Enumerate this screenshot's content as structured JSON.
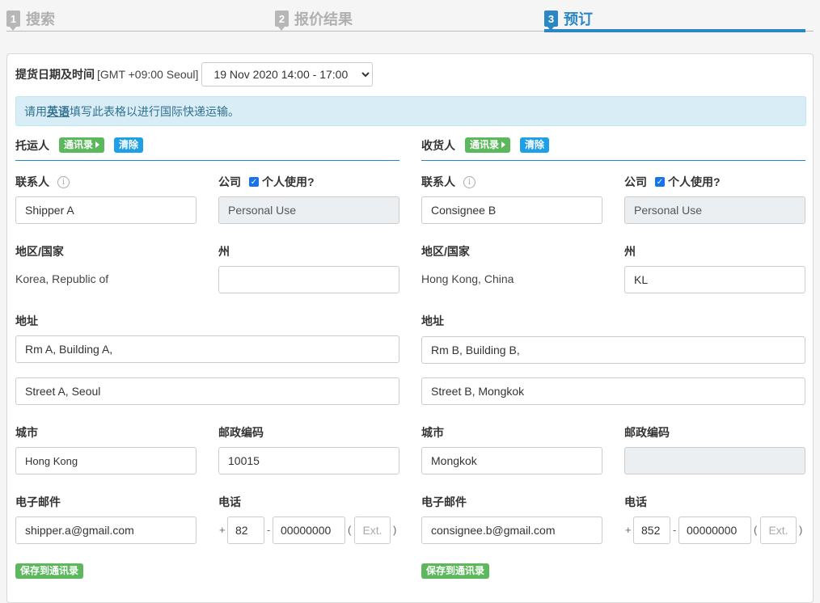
{
  "steps": [
    {
      "num": "1",
      "label": "搜索"
    },
    {
      "num": "2",
      "label": "报价结果"
    },
    {
      "num": "3",
      "label": "预订"
    }
  ],
  "pickup": {
    "label": "提货日期及时间",
    "timezone": "[GMT +09:00 Seoul]",
    "selected": "19 Nov 2020 14:00 - 17:00"
  },
  "notice": {
    "prefix": "请用",
    "emphasis": "英语",
    "suffix": "填写此表格以进行国际快递运输。"
  },
  "shipper": {
    "title": "托运人",
    "address_book": "通讯录",
    "clear": "清除",
    "contact_label": "联系人",
    "contact_value": "Shipper A",
    "company_label": "公司",
    "personal_label": "个人使用?",
    "company_value": "Personal Use",
    "country_label": "地区/国家",
    "country_value": "Korea, Republic of",
    "state_label": "州",
    "state_value": "",
    "address_label": "地址",
    "address1": "Rm A, Building A,",
    "address2": "Street A, Seoul",
    "city_label": "城市",
    "city_value": "Hong Kong",
    "postcode_label": "邮政编码",
    "postcode_value": "10015",
    "email_label": "电子邮件",
    "email_value": "shipper.a@gmail.com",
    "phone_label": "电话",
    "phone_code": "82",
    "phone_number": "00000000",
    "ext_placeholder": "Ext.",
    "save": "保存到通讯录"
  },
  "consignee": {
    "title": "收货人",
    "address_book": "通讯录",
    "clear": "清除",
    "contact_label": "联系人",
    "contact_value": "Consignee B",
    "company_label": "公司",
    "personal_label": "个人使用?",
    "company_value": "Personal Use",
    "country_label": "地区/国家",
    "country_value": "Hong Kong, China",
    "state_label": "州",
    "state_value": "KL",
    "address_label": "地址",
    "address1": "Rm B, Building B,",
    "address2": "Street B, Mongkok",
    "city_label": "城市",
    "city_value": "Mongkok",
    "postcode_label": "邮政编码",
    "postcode_value": "",
    "email_label": "电子邮件",
    "email_value": "consignee.b@gmail.com",
    "phone_label": "电话",
    "phone_code": "852",
    "phone_number": "00000000",
    "ext_placeholder": "Ext.",
    "save": "保存到通讯录"
  },
  "symbols": {
    "plus": "+",
    "dash": "-",
    "open_paren": "(",
    "close_paren": ")"
  },
  "colors": {
    "accent": "#2a86c4",
    "green": "#5cb85c",
    "blue_badge": "#1e9fe6",
    "notice_bg": "#d9edf7"
  }
}
